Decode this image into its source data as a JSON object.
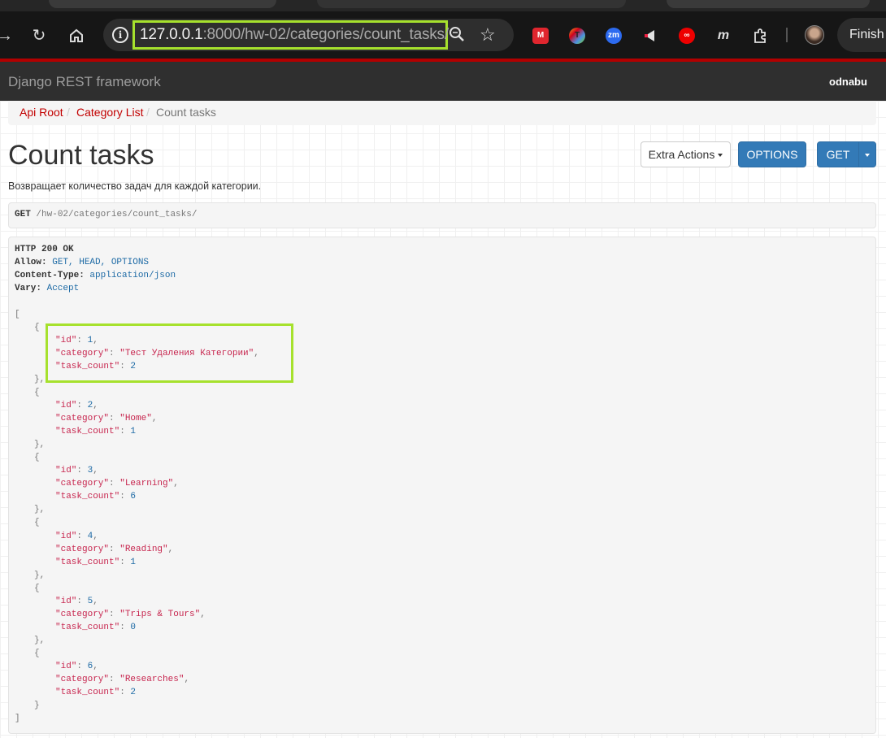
{
  "browser": {
    "url_host": "127.0.0.1",
    "url_rest": ":8000/hw-02/categories/count_tasks/",
    "finish_label": "Finish u",
    "accent_highlight": "#a6e12d",
    "icons": [
      "back-arrow-icon",
      "reload-icon",
      "home-icon",
      "site-info-icon",
      "zoom-icon",
      "bookmark-star-icon",
      "extensions-icon",
      "profile-avatar-icon"
    ]
  },
  "navbar": {
    "brand": "Django REST framework",
    "user": "odnabu"
  },
  "breadcrumb": {
    "items": [
      {
        "label": "Api Root"
      },
      {
        "label": "Category List"
      },
      {
        "label": "Count tasks"
      }
    ],
    "separator": "/"
  },
  "content": {
    "title": "Count tasks",
    "description": "Возвращает количество задач для каждой категории.",
    "buttons": {
      "extra_actions": "Extra Actions",
      "options": "OPTIONS",
      "get": "GET"
    },
    "request": {
      "method": "GET",
      "path": "/hw-02/categories/count_tasks/"
    },
    "response": {
      "status": "HTTP 200 OK",
      "headers": [
        {
          "name": "Allow",
          "value": "GET, HEAD, OPTIONS"
        },
        {
          "name": "Content-Type",
          "value": "application/json"
        },
        {
          "name": "Vary",
          "value": "Accept"
        }
      ],
      "items": [
        {
          "id": 1,
          "category": "Тест Удаления Категории",
          "task_count": 2
        },
        {
          "id": 2,
          "category": "Home",
          "task_count": 1
        },
        {
          "id": 3,
          "category": "Learning",
          "task_count": 6
        },
        {
          "id": 4,
          "category": "Reading",
          "task_count": 1
        },
        {
          "id": 5,
          "category": "Trips & Tours",
          "task_count": 0
        },
        {
          "id": 6,
          "category": "Researches",
          "task_count": 2
        }
      ]
    }
  },
  "colors": {
    "link": "#c20000",
    "primary_button": "#337ab7",
    "json_string": "#c7254e",
    "json_number": "#1d6aa5",
    "navbar_bg": "#2f2f2f"
  }
}
